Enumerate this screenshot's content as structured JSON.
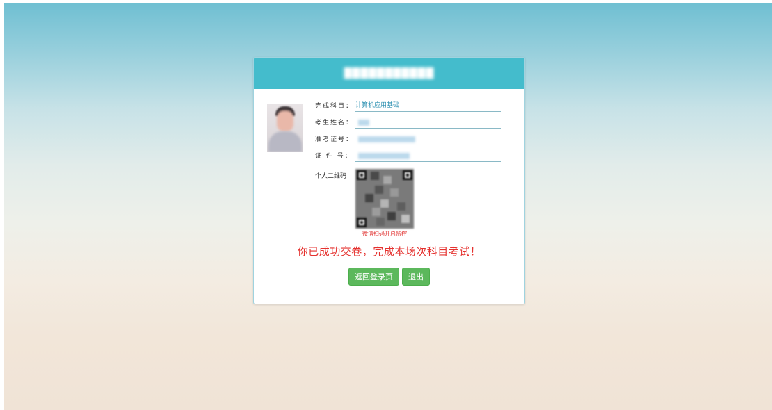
{
  "card": {
    "title": "███████████"
  },
  "fields": [
    {
      "label": "完成科目：",
      "value": "计算机应用基础"
    },
    {
      "label": "考生姓名：",
      "value": ""
    },
    {
      "label": "准考证号：",
      "value": ""
    },
    {
      "label": "证 件 号：",
      "value": ""
    }
  ],
  "qr": {
    "label": "个人二维码",
    "caption": "微信扫码开启监控"
  },
  "message": "你已成功交卷，完成本场次科目考试！",
  "buttons": {
    "back_label": "返回登录页",
    "exit_label": "退出"
  },
  "colors": {
    "header": "#44bccc",
    "success_text": "#e5322f",
    "button": "#5cb85c",
    "field_value": "#2a8fb0"
  }
}
